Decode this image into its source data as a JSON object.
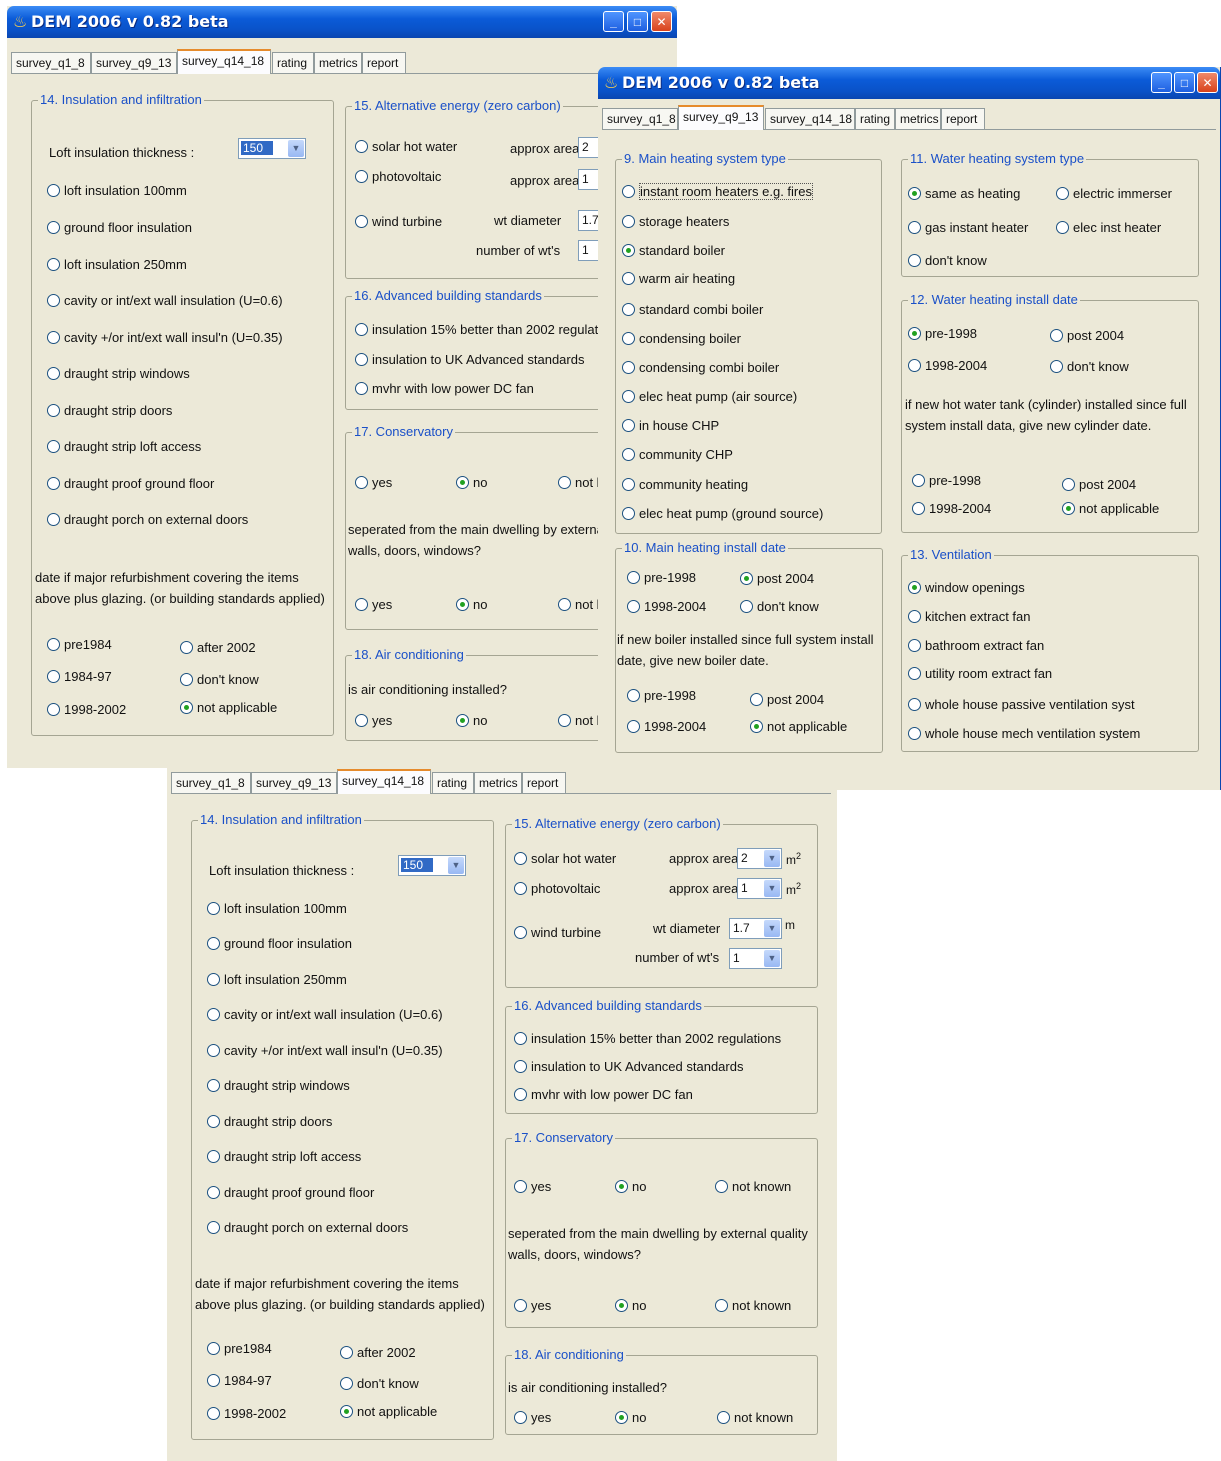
{
  "window": {
    "title": "DEM 2006 v 0.82 beta",
    "tabs": [
      "survey_q1_8",
      "survey_q9_13",
      "survey_q14_18",
      "rating",
      "metrics",
      "report"
    ]
  },
  "q14": {
    "legend": "14. Insulation and infiltration",
    "loft_label": "Loft insulation thickness :",
    "loft_value": "150",
    "options": [
      "loft insulation 100mm",
      "ground floor insulation",
      "loft insulation 250mm",
      "cavity or int/ext wall insulation (U=0.6)",
      "cavity +/or int/ext wall insul'n  (U=0.35)",
      "draught strip windows",
      "draught strip doors",
      "draught strip loft access",
      "draught proof ground floor",
      "draught porch on external doors"
    ],
    "date_note": "date if major refurbishment covering the items above plus glazing. (or building standards applied)",
    "dates": [
      "pre1984",
      "after 2002",
      "1984-97",
      "don't know",
      "1998-2002",
      "not applicable"
    ]
  },
  "q15": {
    "legend": "15. Alternative energy (zero carbon)",
    "solar": "solar hot water",
    "pv": "photovoltaic",
    "wind": "wind turbine",
    "approx_area": "approx area",
    "area_solar": "2",
    "area_pv": "1",
    "wt_diameter": "wt diameter",
    "wt_diameter_value": "1.7",
    "num_wt": "number of wt's",
    "num_wt_value": "1",
    "unit_m2": "m",
    "unit_m": "m",
    "sup": "2"
  },
  "q16": {
    "legend": "16. Advanced building standards",
    "options": [
      "insulation 15% better than 2002 regulations",
      "insulation to UK Advanced standards",
      "mvhr with low power DC fan"
    ]
  },
  "q17": {
    "legend": "17. Conservatory",
    "yes": "yes",
    "no": "no",
    "not_known": "not known",
    "note": "seperated from the main dwelling by external quality walls, doors, windows?"
  },
  "q18": {
    "legend": "18. Air conditioning",
    "question": "is air conditioning installed?",
    "yes": "yes",
    "no": "no",
    "not_known": "not known"
  },
  "q9": {
    "legend": "9. Main heating system type",
    "options": [
      "instant room heaters e.g. fires",
      "storage heaters",
      "standard boiler",
      "warm air heating",
      "standard combi boiler",
      "condensing boiler",
      "condensing combi boiler",
      "elec heat pump (air source)",
      "in house CHP",
      "community CHP",
      "community heating",
      "elec heat pump (ground source)"
    ]
  },
  "q10": {
    "legend": "10. Main heating install date",
    "pre": "pre-1998",
    "post": "post 2004",
    "mid": "1998-2004",
    "dont": "don't know",
    "note": "if new boiler installed since full system install date, give new boiler date.",
    "na": "not applicable"
  },
  "q11": {
    "legend": "11. Water heating system type",
    "same": "same as heating",
    "immerser": "electric immerser",
    "gas": "gas instant heater",
    "elec": "elec inst heater",
    "dont": "don't know"
  },
  "q12": {
    "legend": "12. Water heating install date",
    "pre": "pre-1998",
    "post": "post 2004",
    "mid": "1998-2004",
    "dont": "don't know",
    "note": "if new hot water tank (cylinder) installed since full system install data, give new cylinder date.",
    "na": "not applicable"
  },
  "q13": {
    "legend": "13. Ventilation",
    "options": [
      "window openings",
      "kitchen extract fan",
      "bathroom extract fan",
      "utility room extract fan",
      "whole house passive ventilation syst",
      "whole house mech ventilation system"
    ]
  }
}
